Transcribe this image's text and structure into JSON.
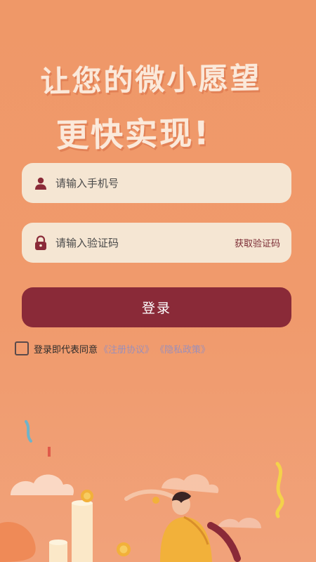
{
  "hero": {
    "line1": "让您的微小愿望",
    "line2": "更快实现!"
  },
  "phone_field": {
    "placeholder": "请输入手机号",
    "icon": "user-icon"
  },
  "code_field": {
    "placeholder": "请输入验证码",
    "icon": "lock-icon",
    "get_code_label": "获取验证码"
  },
  "login_button": {
    "label": "登录"
  },
  "agreement": {
    "text": "登录即代表同意",
    "links": [
      "《注册协议》",
      "《隐私政策》"
    ]
  },
  "colors": {
    "background": "#ef9868",
    "field_bg": "#f5e6d3",
    "accent": "#8a2a38",
    "link": "#9c8fb8"
  }
}
